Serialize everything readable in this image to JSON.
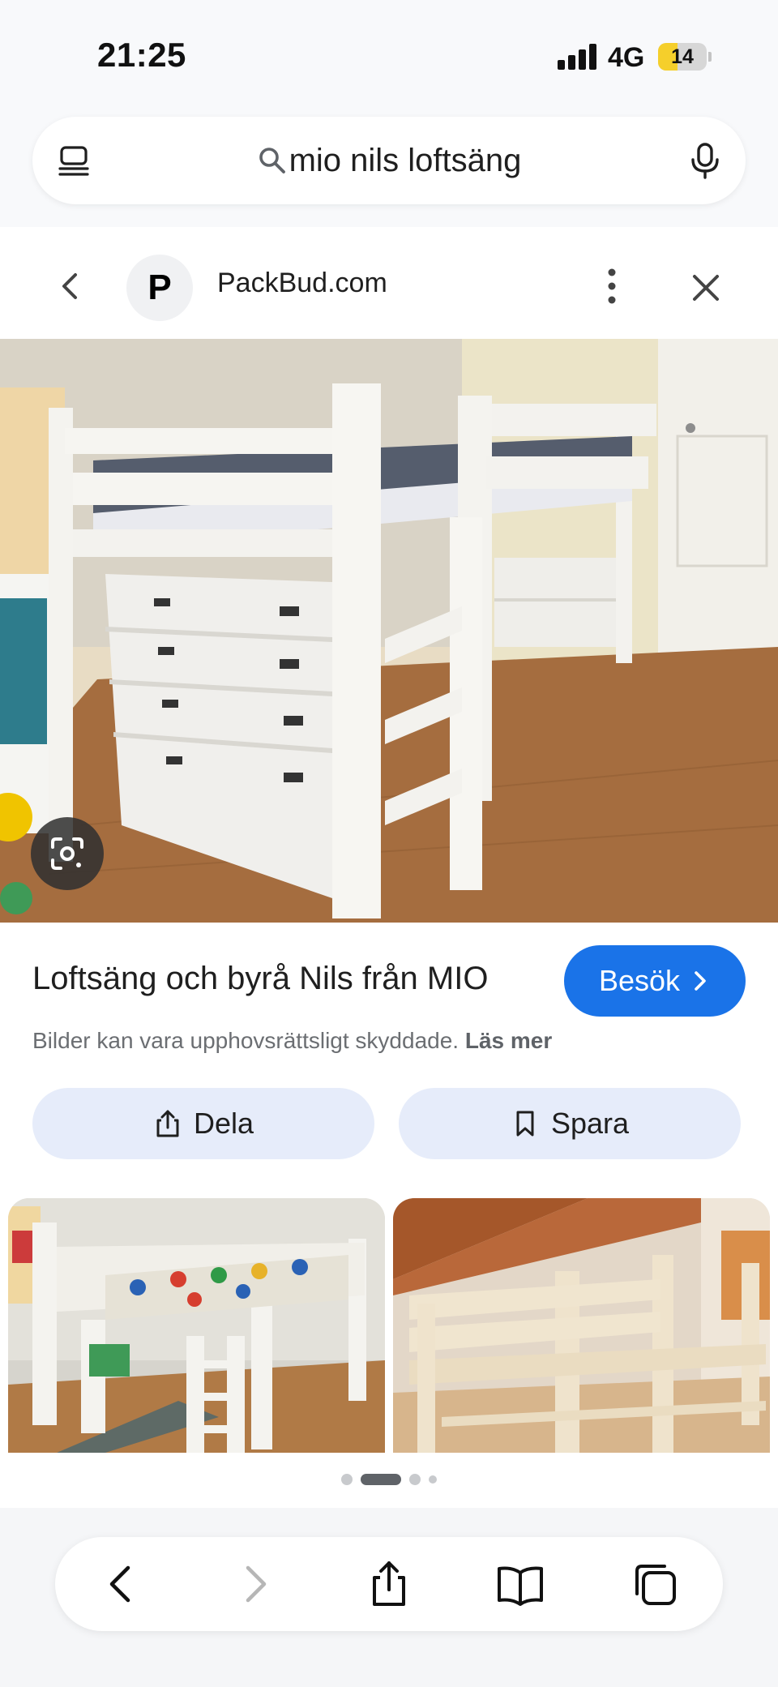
{
  "status_bar": {
    "time": "21:25",
    "network": "4G",
    "battery_level": "14",
    "battery_fraction": 0.14
  },
  "search": {
    "query": "mio nils loftsäng"
  },
  "source": {
    "favicon_letter": "P",
    "name": "PackBud.com"
  },
  "result": {
    "title": "Loftsäng och byrå Nils från MIO",
    "visit_label": "Besök",
    "copyright_text": "Bilder kan vara upphovsrättsligt skyddade.",
    "read_more": "Läs mer"
  },
  "actions": {
    "share_label": "Dela",
    "save_label": "Spara"
  },
  "pagination": {
    "count": 4,
    "active": 1
  },
  "icons": {
    "tabs": "tabs-list-icon",
    "search": "search-icon",
    "mic": "mic-icon",
    "back": "chevron-left-icon",
    "more": "more-vertical-icon",
    "close": "close-icon",
    "lens": "google-lens-icon",
    "visit": "chevron-right-icon",
    "share": "share-icon",
    "save": "bookmark-icon",
    "browser_back": "back-icon",
    "browser_forward": "forward-icon",
    "browser_share": "share-icon",
    "browser_bookmarks": "bookmarks-icon",
    "browser_tabs": "tabs-icon"
  },
  "colors": {
    "accent": "#1a73e8",
    "pill_bg": "#e6ecfa",
    "muted_text": "#6b6e72"
  }
}
